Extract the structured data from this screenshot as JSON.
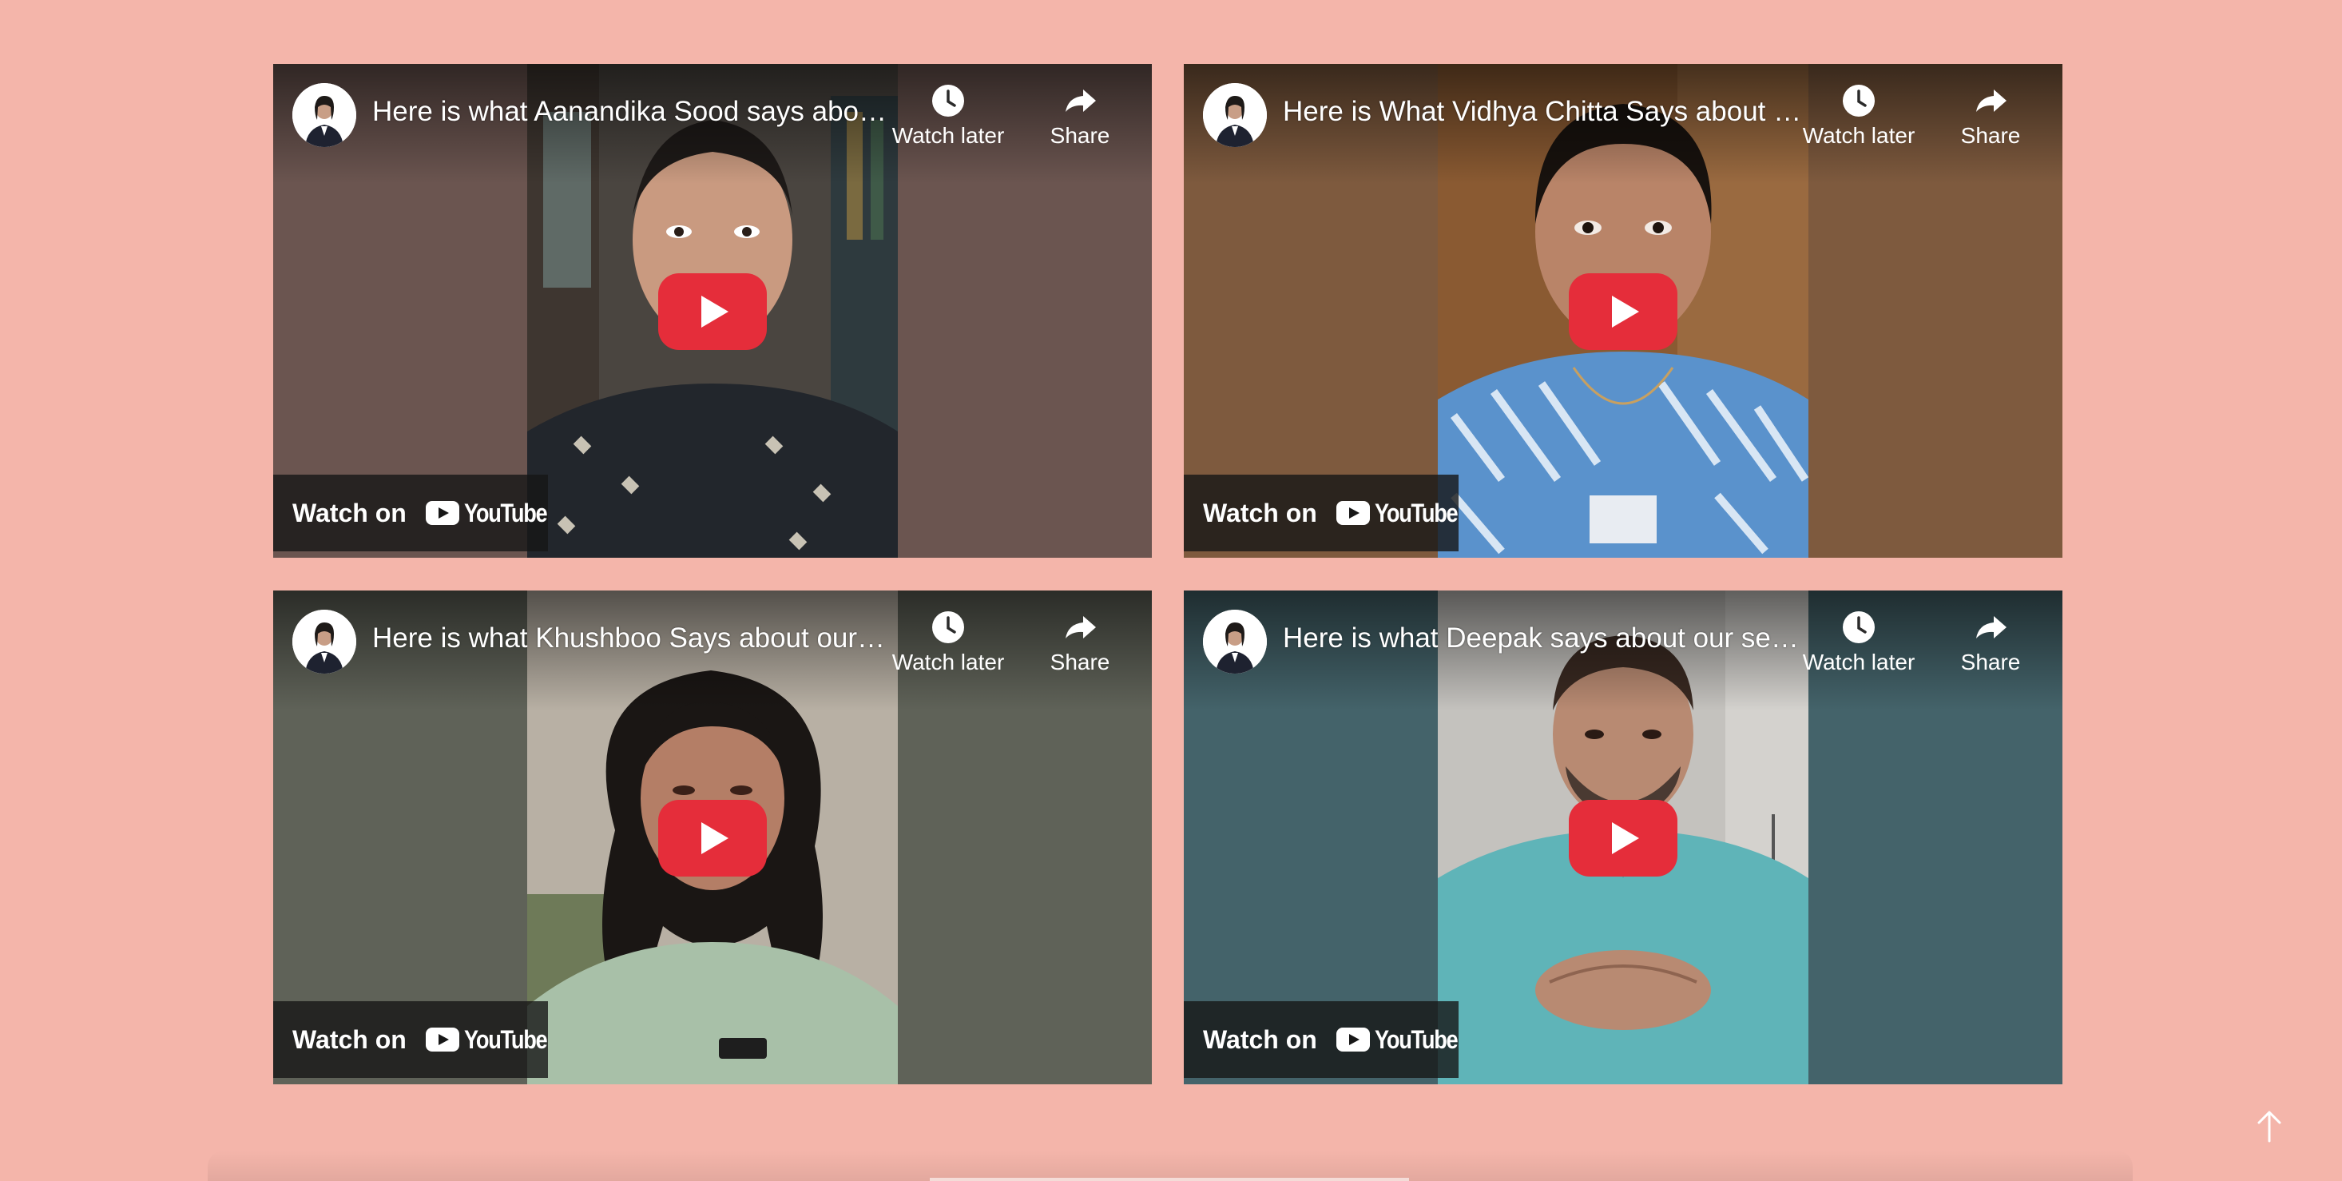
{
  "page": {
    "background": "#F4B5AA"
  },
  "videos": [
    {
      "title": "Here is what Aanandika Sood says about our services",
      "watch_later_label": "Watch later",
      "share_label": "Share",
      "watch_on_label": "Watch on",
      "youtube_label": "YouTube",
      "bg_color": "#6B5550",
      "scene_color": "#5A5548"
    },
    {
      "title": "Here is What Vidhya Chitta Says about our services",
      "watch_later_label": "Watch later",
      "share_label": "Share",
      "watch_on_label": "Watch on",
      "youtube_label": "YouTube",
      "bg_color": "#7E5A3E",
      "scene_color": "#8A5A32"
    },
    {
      "title": "Here is what Khushboo Says about our services",
      "watch_later_label": "Watch later",
      "share_label": "Share",
      "watch_on_label": "Watch on",
      "youtube_label": "YouTube",
      "bg_color": "#5F6258",
      "scene_color": "#B8B0A4"
    },
    {
      "title": "Here is what Deepak says about our services",
      "watch_later_label": "Watch later",
      "share_label": "Share",
      "watch_on_label": "Watch on",
      "youtube_label": "YouTube",
      "bg_color": "#44636A",
      "scene_color": "#C4C2BE"
    }
  ],
  "colors": {
    "play_red": "#E52D3A",
    "overlay_dark": "#171717"
  },
  "icons": {
    "watch_later": "clock-icon",
    "share": "share-arrow-icon",
    "play": "play-icon",
    "youtube": "youtube-logo-icon",
    "scroll_top": "arrow-up-icon"
  }
}
